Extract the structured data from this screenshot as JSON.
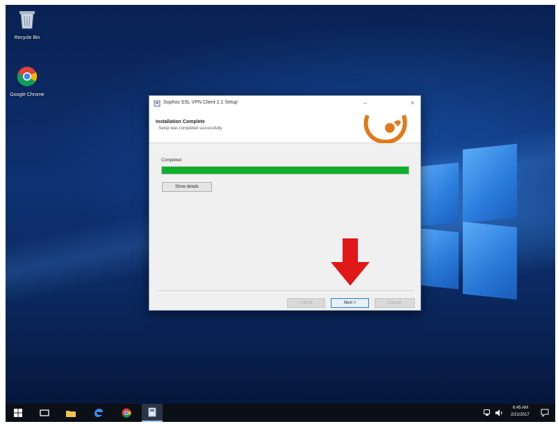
{
  "desktop": {
    "icons": [
      {
        "label": "Recycle Bin",
        "icon": "recycle-bin-icon"
      },
      {
        "label": "Google Chrome",
        "icon": "chrome-icon"
      }
    ]
  },
  "dialog": {
    "title": "Sophos SSL VPN Client 2.1 Setup",
    "minimize": "–",
    "close": "×",
    "header_title": "Installation Complete",
    "header_subtitle": "Setup was completed successfully.",
    "status_label": "Completed",
    "progress_percent": 100,
    "show_details_label": "Show details",
    "back_label": "< Back",
    "next_label": "Next >",
    "cancel_label": "Cancel",
    "brand_color": "#e07a1c"
  },
  "annotation": {
    "icon": "red-down-arrow-icon",
    "color": "#e01818"
  },
  "taskbar": {
    "items": [
      "start-icon",
      "task-view-icon",
      "file-explorer-icon",
      "edge-icon",
      "chrome-icon",
      "setup-app-icon"
    ],
    "clock_time": "6:45 AM",
    "clock_date": "2/21/2017"
  },
  "colors": {
    "progress": "#0cae2a",
    "taskbar": "#0b0f16",
    "next_button_border": "#2b78d8"
  }
}
